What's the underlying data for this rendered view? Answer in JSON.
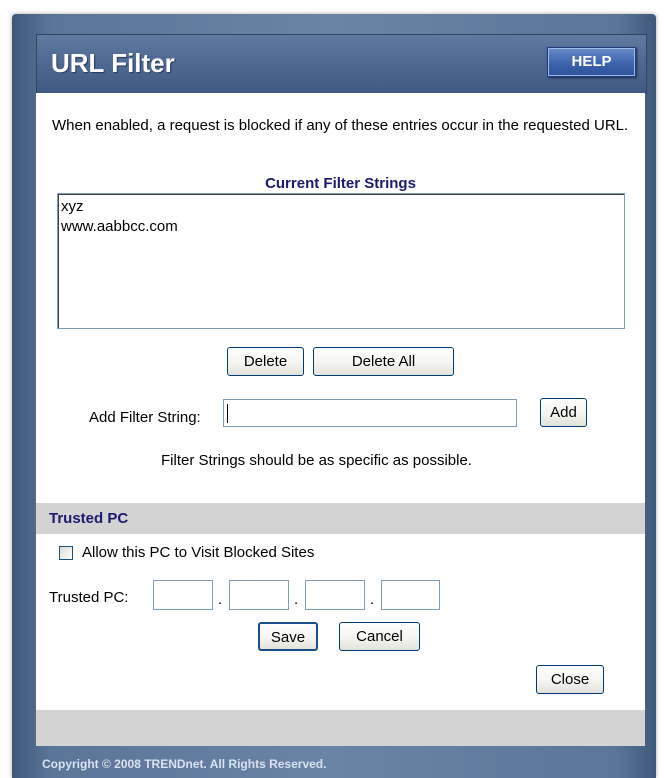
{
  "window": {
    "title": "URL Filter",
    "help_label": "HELP",
    "copyright": "Copyright © 2008 TRENDnet. All Rights Reserved."
  },
  "url_filter": {
    "description": "When enabled, a request is blocked if any of these entries occur in the requested URL.",
    "list_caption": "Current Filter Strings",
    "filter_strings": [
      "xyz",
      "www.aabbcc.com"
    ],
    "delete_label": "Delete",
    "delete_all_label": "Delete All",
    "add_label_text": "Add Filter String:",
    "add_input_value": "",
    "add_button_label": "Add",
    "hint": "Filter Strings should be as specific as possible."
  },
  "trusted_pc": {
    "section_title": "Trusted PC",
    "allow_label": "Allow this PC to Visit Blocked Sites",
    "allow_checked": false,
    "ip_label": "Trusted PC:",
    "ip_octets": [
      "",
      "",
      "",
      ""
    ],
    "save_label": "Save",
    "cancel_label": "Cancel",
    "close_label": "Close"
  },
  "colors": {
    "header_blue": "#4c6790",
    "help_blue": "#3f66b0",
    "caption_navy": "#1a1a6e",
    "section_grey": "#d3d3d3"
  }
}
